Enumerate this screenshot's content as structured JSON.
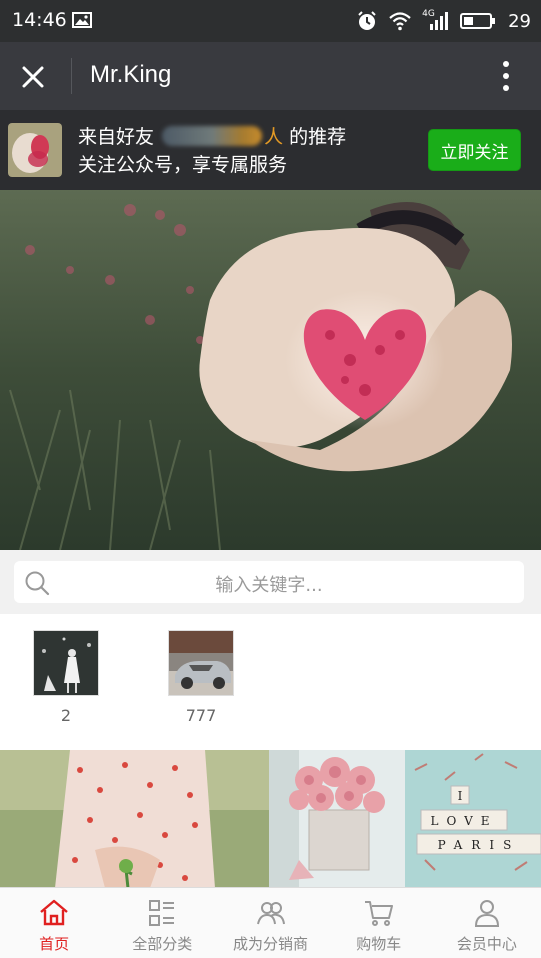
{
  "status_bar": {
    "time": "14:46",
    "network": "4G",
    "battery": "29"
  },
  "header": {
    "title": "Mr.King"
  },
  "follow_banner": {
    "line1_prefix": "来自好友",
    "line1_highlight": "人",
    "line1_suffix": "的推荐",
    "line2": "关注公众号，享专属服务",
    "follow_button": "立即关注"
  },
  "search": {
    "placeholder": "输入关键字..."
  },
  "categories": [
    {
      "label": "2"
    },
    {
      "label": "777"
    }
  ],
  "hero_image": {
    "subject": "hands-holding-petal-heart"
  },
  "product_tiles": [
    {
      "subject": "girl-in-polka-dot-dress"
    },
    {
      "subject": "rose-bouquet-in-tin"
    },
    {
      "subject": "letter-tiles-photo"
    }
  ],
  "product_tile_text": {
    "line1": "I",
    "line2": "LOVE",
    "line3": "PARIS"
  },
  "bottom_nav": [
    {
      "label": "首页",
      "icon": "home-icon",
      "active": true
    },
    {
      "label": "全部分类",
      "icon": "category-icon",
      "active": false
    },
    {
      "label": "成为分销商",
      "icon": "distributor-icon",
      "active": false
    },
    {
      "label": "购物车",
      "icon": "cart-icon",
      "active": false
    },
    {
      "label": "会员中心",
      "icon": "user-icon",
      "active": false
    }
  ],
  "colors": {
    "accent": "#e02020",
    "follow_green": "#1aad19",
    "header_bg": "#393a3f"
  }
}
